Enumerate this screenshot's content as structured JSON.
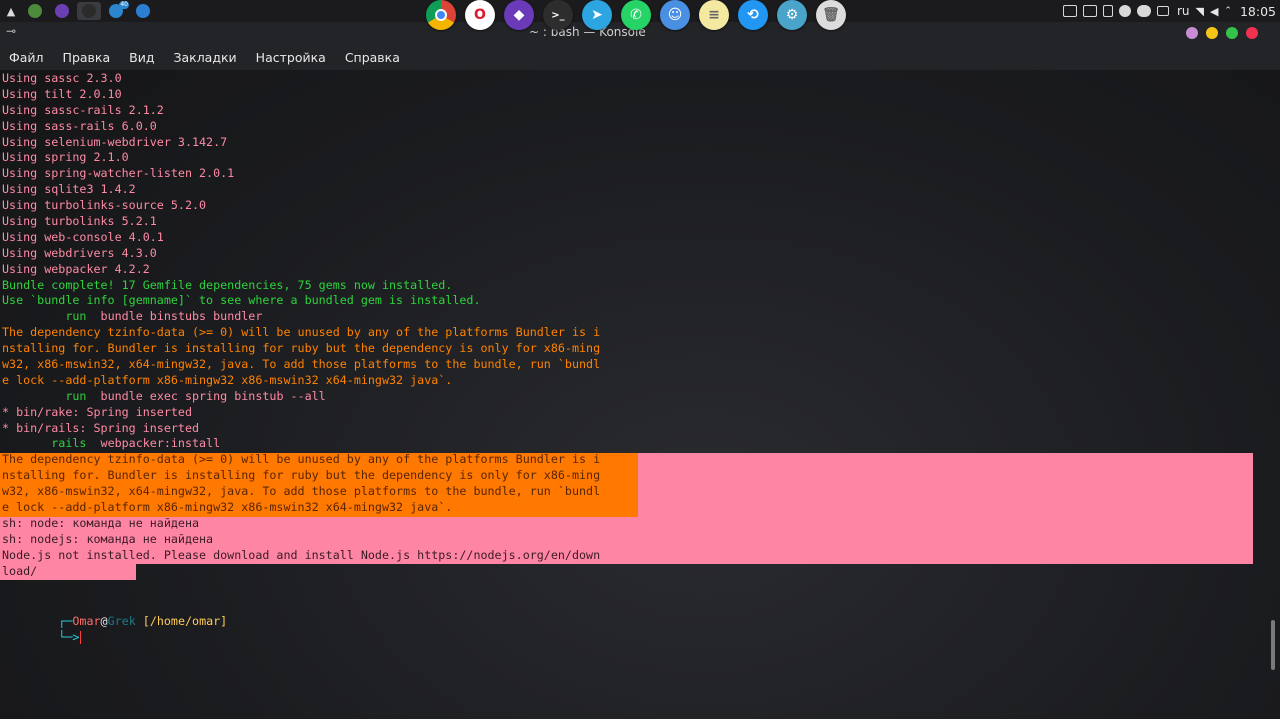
{
  "top_panel": {
    "launcher_icon": "kde-launcher-icon",
    "task_apps": [
      {
        "name": "chrome",
        "color": "#4b8b3b"
      },
      {
        "name": "visual-studio-code",
        "color": "#6a3fb3"
      },
      {
        "name": "konsole",
        "color": "#2b2b2b"
      },
      {
        "name": "telegram",
        "color": "#2b86cc"
      },
      {
        "name": "browser",
        "color": "#2b7fd3"
      }
    ],
    "task_badge": "40",
    "dock": [
      {
        "name": "chrome",
        "color": "#dd4b39",
        "glyph": ""
      },
      {
        "name": "opera",
        "color": "#ffffff",
        "glyph": "O"
      },
      {
        "name": "visual-studio",
        "color": "#6b3ab8",
        "glyph": "◆"
      },
      {
        "name": "terminal",
        "color": "#2d2d2d",
        "glyph": ">_"
      },
      {
        "name": "telegram",
        "color": "#2ca5e0",
        "glyph": "➤"
      },
      {
        "name": "whatsapp",
        "color": "#25d366",
        "glyph": "✆"
      },
      {
        "name": "finder",
        "color": "#4a90e2",
        "glyph": "☺"
      },
      {
        "name": "notes",
        "color": "#f3e9a0",
        "glyph": "≡"
      },
      {
        "name": "share",
        "color": "#2196f3",
        "glyph": "⟲"
      },
      {
        "name": "settings",
        "color": "#4aa3c8",
        "glyph": "⚙"
      },
      {
        "name": "trash",
        "color": "#dcdcdc",
        "glyph": "🗑"
      }
    ],
    "language": "ru",
    "time": "18:05"
  },
  "window": {
    "title": "~ : bash — Konsole",
    "menu_glyph": "⊸",
    "buttons": [
      {
        "name": "keep-above-button",
        "color": "#c98bd3"
      },
      {
        "name": "minimize-button",
        "color": "#f5c518"
      },
      {
        "name": "maximize-button",
        "color": "#34c24a"
      },
      {
        "name": "close-button",
        "color": "#f0314f"
      }
    ]
  },
  "menubar": {
    "items": [
      "Файл",
      "Правка",
      "Вид",
      "Закладки",
      "Настройка",
      "Справка"
    ]
  },
  "terminal": {
    "lines": [
      {
        "text": "Using sassc 2.3.0",
        "cls": "c-pink"
      },
      {
        "text": "Using tilt 2.0.10",
        "cls": "c-pink"
      },
      {
        "text": "Using sassc-rails 2.1.2",
        "cls": "c-pink"
      },
      {
        "text": "Using sass-rails 6.0.0",
        "cls": "c-pink"
      },
      {
        "text": "Using selenium-webdriver 3.142.7",
        "cls": "c-pink"
      },
      {
        "text": "Using spring 2.1.0",
        "cls": "c-pink"
      },
      {
        "text": "Using spring-watcher-listen 2.0.1",
        "cls": "c-pink"
      },
      {
        "text": "Using sqlite3 1.4.2",
        "cls": "c-pink"
      },
      {
        "text": "Using turbolinks-source 5.2.0",
        "cls": "c-pink"
      },
      {
        "text": "Using turbolinks 5.2.1",
        "cls": "c-pink"
      },
      {
        "text": "Using web-console 4.0.1",
        "cls": "c-pink"
      },
      {
        "text": "Using webdrivers 4.3.0",
        "cls": "c-pink"
      },
      {
        "text": "Using webpacker 4.2.2",
        "cls": "c-pink"
      },
      {
        "text": "Bundle complete! 17 Gemfile dependencies, 75 gems now installed.",
        "cls": "c-green"
      },
      {
        "text": "Use `bundle info [gemname]` to see where a bundled gem is installed.",
        "cls": "c-green"
      },
      {
        "text": "         run  bundle binstubs bundler",
        "cls": "c-pink",
        "cmd": true
      },
      {
        "text": "The dependency tzinfo-data (>= 0) will be unused by any of the platforms Bundler is i",
        "cls": "c-orange"
      },
      {
        "text": "nstalling for. Bundler is installing for ruby but the dependency is only for x86-ming",
        "cls": "c-orange"
      },
      {
        "text": "w32, x86-mswin32, x64-mingw32, java. To add those platforms to the bundle, run `bundl",
        "cls": "c-orange"
      },
      {
        "text": "e lock --add-platform x86-mingw32 x86-mswin32 x64-mingw32 java`.",
        "cls": "c-orange"
      },
      {
        "text": "         run  bundle exec spring binstub --all",
        "cls": "c-pink",
        "cmd": true
      },
      {
        "text": "* bin/rake: Spring inserted",
        "cls": "c-pink"
      },
      {
        "text": "* bin/rails: Spring inserted",
        "cls": "c-pink"
      },
      {
        "text": "       rails  webpacker:install",
        "cls": "c-pink",
        "cmd": true
      },
      {
        "text": "The dependency tzinfo-data (>= 0) will be unused by any of the platforms Bundler is i",
        "cls": "hl-orange"
      },
      {
        "text": "nstalling for. Bundler is installing for ruby but the dependency is only for x86-ming",
        "cls": "hl-orange"
      },
      {
        "text": "w32, x86-mswin32, x64-mingw32, java. To add those platforms to the bundle, run `bundl",
        "cls": "hl-orange"
      },
      {
        "text": "e lock --add-platform x86-mingw32 x86-mswin32 x64-mingw32 java`.",
        "cls": "hl-orange"
      },
      {
        "text": "sh: node: команда не найдена",
        "cls": "hl-pink"
      },
      {
        "text": "sh: nodejs: команда не найдена",
        "cls": "hl-pink"
      },
      {
        "text": "Node.js not installed. Please download and install Node.js https://nodejs.org/en/down",
        "cls": "hl-pink"
      },
      {
        "text": "load/",
        "cls": "hl-pink"
      }
    ],
    "prompt": {
      "corner_top": "┌─",
      "user": "Omar",
      "at": "@",
      "host": "Grek",
      "path": "[/home/omar]",
      "corner_bottom": "└─>"
    }
  }
}
